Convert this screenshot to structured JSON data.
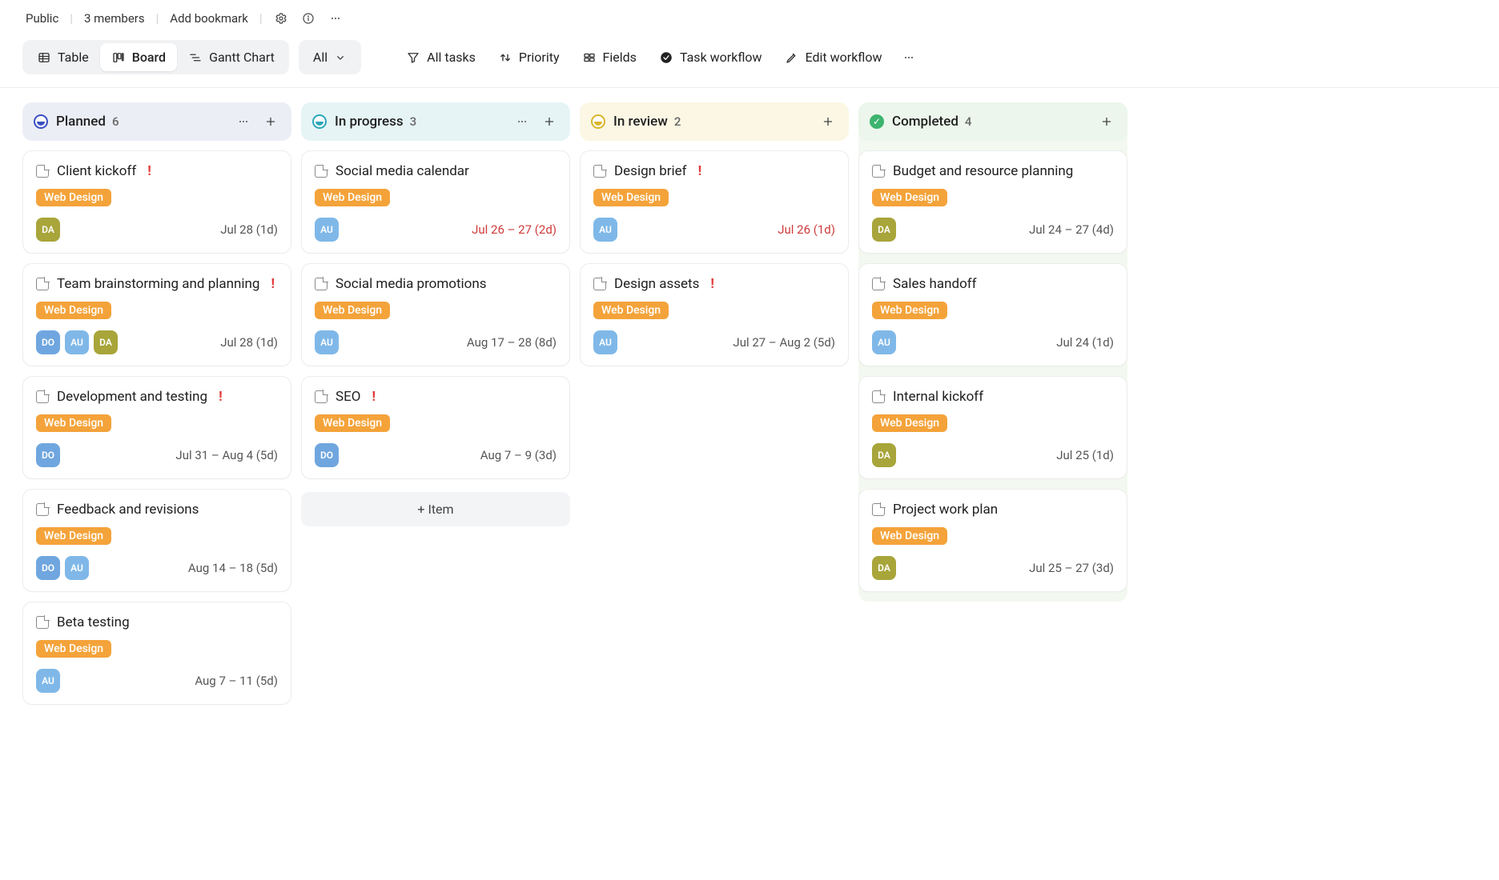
{
  "top": {
    "visibility": "Public",
    "members": "3 members",
    "add_bookmark": "Add bookmark"
  },
  "views": {
    "table": "Table",
    "board": "Board",
    "gantt": "Gantt Chart",
    "all": "All"
  },
  "filters": {
    "all_tasks": "All tasks",
    "priority": "Priority",
    "fields": "Fields",
    "task_workflow": "Task workflow",
    "edit_workflow": "Edit workflow"
  },
  "columns": [
    {
      "key": "planned",
      "title": "Planned",
      "count": "6",
      "show_more_icon": true,
      "cards": [
        {
          "title": "Client kickoff",
          "priority": true,
          "tag": "Web Design",
          "avatars": [
            "DA"
          ],
          "date": "Jul 28 (1d)",
          "overdue": false
        },
        {
          "title": "Team brainstorming and planning",
          "priority": true,
          "tag": "Web Design",
          "avatars": [
            "DO",
            "AU",
            "DA"
          ],
          "date": "Jul 28 (1d)",
          "overdue": false
        },
        {
          "title": "Development and testing",
          "priority": true,
          "tag": "Web Design",
          "avatars": [
            "DO"
          ],
          "date": "Jul 31 – Aug 4 (5d)",
          "overdue": false
        },
        {
          "title": "Feedback and revisions",
          "priority": false,
          "tag": "Web Design",
          "avatars": [
            "DO",
            "AU"
          ],
          "date": "Aug 14 – 18 (5d)",
          "overdue": false
        },
        {
          "title": "Beta testing",
          "priority": false,
          "tag": "Web Design",
          "avatars": [
            "AU"
          ],
          "date": "Aug 7 – 11 (5d)",
          "overdue": false
        }
      ],
      "add_item": null
    },
    {
      "key": "inprog",
      "title": "In progress",
      "count": "3",
      "show_more_icon": true,
      "cards": [
        {
          "title": "Social media calendar",
          "priority": false,
          "tag": "Web Design",
          "avatars": [
            "AU"
          ],
          "date": "Jul 26 – 27 (2d)",
          "overdue": true
        },
        {
          "title": "Social media promotions",
          "priority": false,
          "tag": "Web Design",
          "avatars": [
            "AU"
          ],
          "date": "Aug 17 – 28 (8d)",
          "overdue": false
        },
        {
          "title": "SEO",
          "priority": true,
          "tag": "Web Design",
          "avatars": [
            "DO"
          ],
          "date": "Aug 7 – 9 (3d)",
          "overdue": false
        }
      ],
      "add_item": "+ Item"
    },
    {
      "key": "inreview",
      "title": "In review",
      "count": "2",
      "show_more_icon": false,
      "cards": [
        {
          "title": "Design brief",
          "priority": true,
          "tag": "Web Design",
          "avatars": [
            "AU"
          ],
          "date": "Jul 26 (1d)",
          "overdue": true
        },
        {
          "title": "Design assets",
          "priority": true,
          "tag": "Web Design",
          "avatars": [
            "AU"
          ],
          "date": "Jul 27 – Aug 2 (5d)",
          "overdue": false
        }
      ],
      "add_item": null
    },
    {
      "key": "completed",
      "title": "Completed",
      "count": "4",
      "show_more_icon": false,
      "cards": [
        {
          "title": "Budget and resource planning",
          "priority": false,
          "tag": "Web Design",
          "avatars": [
            "DA"
          ],
          "date": "Jul 24 – 27 (4d)",
          "overdue": false
        },
        {
          "title": "Sales handoff",
          "priority": false,
          "tag": "Web Design",
          "avatars": [
            "AU"
          ],
          "date": "Jul 24 (1d)",
          "overdue": false
        },
        {
          "title": "Internal kickoff",
          "priority": false,
          "tag": "Web Design",
          "avatars": [
            "DA"
          ],
          "date": "Jul 25 (1d)",
          "overdue": false
        },
        {
          "title": "Project work plan",
          "priority": false,
          "tag": "Web Design",
          "avatars": [
            "DA"
          ],
          "date": "Jul 25 – 27 (3d)",
          "overdue": false
        }
      ],
      "add_item": null
    }
  ]
}
